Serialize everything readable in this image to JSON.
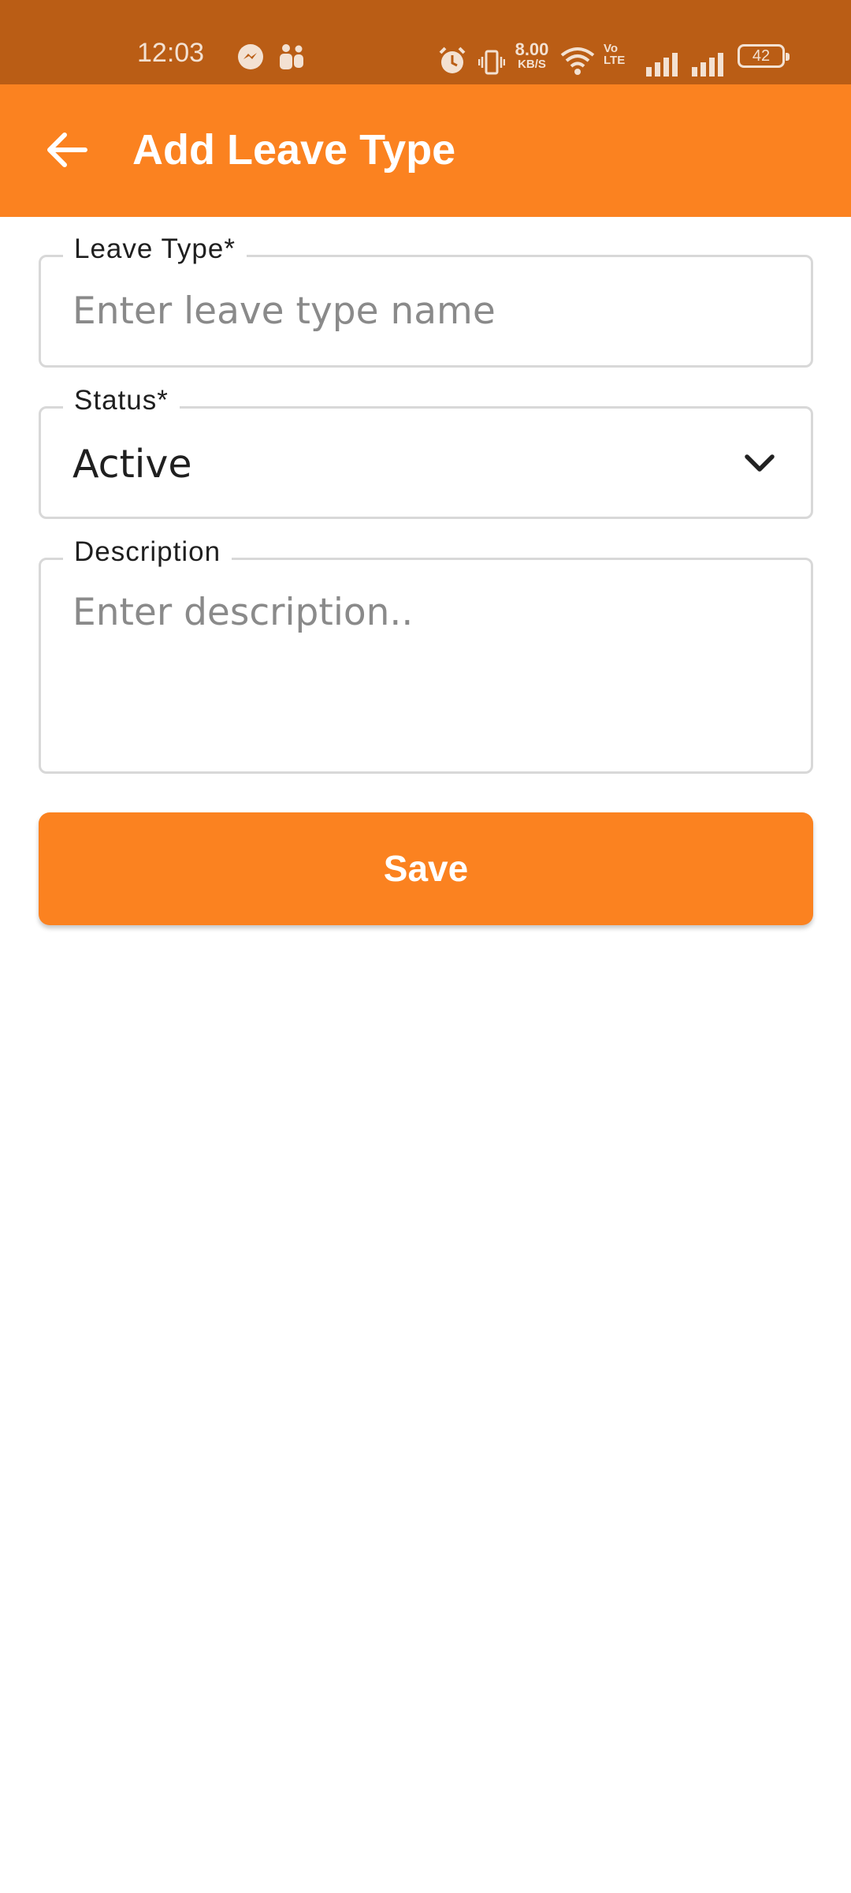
{
  "status_bar": {
    "time": "12:03",
    "net_speed_value": "8.00",
    "net_speed_unit": "KB/S",
    "volte_top": "Vo",
    "volte_bottom": "LTE",
    "battery": "42"
  },
  "app_bar": {
    "title": "Add Leave Type"
  },
  "form": {
    "leave_type": {
      "label": "Leave Type*",
      "placeholder": "Enter leave type name",
      "value": ""
    },
    "status": {
      "label": "Status*",
      "selected": "Active"
    },
    "description": {
      "label": "Description",
      "placeholder": "Enter description..",
      "value": ""
    },
    "save_label": "Save"
  },
  "colors": {
    "status_bar": "#BA5D15",
    "primary": "#FB8220",
    "border": "#D8D8D8"
  },
  "icons": [
    "messenger-icon",
    "teams-icon",
    "alarm-icon",
    "vibrate-icon",
    "wifi-icon",
    "signal-icon",
    "battery-icon",
    "back-arrow-icon",
    "chevron-down-icon"
  ]
}
